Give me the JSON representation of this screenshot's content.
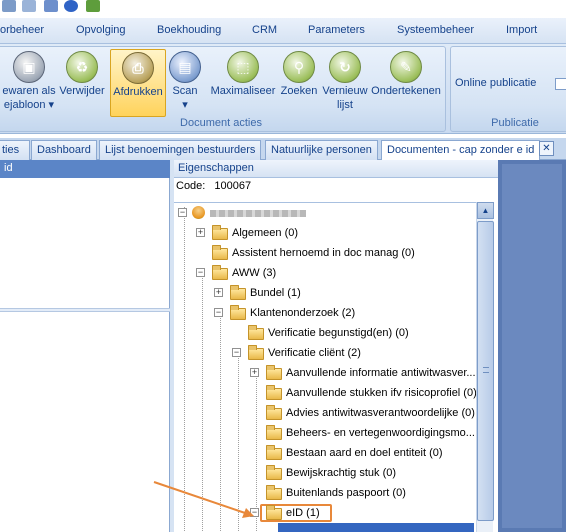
{
  "menu": {
    "tabs": [
      "orbeheer",
      "Opvolging",
      "Boekhouding",
      "CRM",
      "Parameters",
      "Systeembeheer",
      "Import"
    ]
  },
  "ribbon": {
    "buttons": [
      {
        "label": "ewaren als",
        "label2": "ejabloon ▾",
        "icon": "save-template-icon"
      },
      {
        "label": "Verwijder",
        "label2": "",
        "icon": "delete-icon"
      },
      {
        "label": "Afdrukken",
        "label2": "",
        "icon": "print-icon"
      },
      {
        "label": "Scan",
        "label2": "▾",
        "icon": "scan-icon"
      },
      {
        "label": "Maximaliseer",
        "label2": "",
        "icon": "maximize-icon"
      },
      {
        "label": "Zoeken",
        "label2": "",
        "icon": "search-icon"
      },
      {
        "label": "Vernieuw",
        "label2": "lijst",
        "icon": "refresh-icon"
      },
      {
        "label": "Ondertekenen",
        "label2": "",
        "icon": "sign-icon"
      }
    ],
    "group_label": "Document acties",
    "publicatie": {
      "online_label": "Online publicatie",
      "group_label": "Publicatie"
    }
  },
  "doc_tabs": [
    {
      "label": "ties"
    },
    {
      "label": "Dashboard"
    },
    {
      "label": "Lijst benoemingen bestuurders"
    },
    {
      "label": "Natuurlijke personen"
    },
    {
      "label": "Documenten - cap zonder e id"
    }
  ],
  "left_panel": {
    "header": "id"
  },
  "properties": {
    "header": "Eigenschappen",
    "code_label": "Code:",
    "code_value": "100067"
  },
  "tree": [
    {
      "label": "Algemeen (0)",
      "level": 1
    },
    {
      "label": "Assistent hernoemd in doc manag (0)",
      "level": 1
    },
    {
      "label": "AWW (3)",
      "level": 1
    },
    {
      "label": "Bundel (1)",
      "level": 2
    },
    {
      "label": "Klantenonderzoek (2)",
      "level": 2
    },
    {
      "label": "Verificatie begunstigd(en) (0)",
      "level": 3
    },
    {
      "label": "Verificatie cliënt (2)",
      "level": 3
    },
    {
      "label": "Aanvullende informatie antiwitwasver...",
      "level": 4
    },
    {
      "label": "Aanvullende stukken ifv risicoprofiel (0)",
      "level": 4
    },
    {
      "label": "Advies antiwitwasverantwoordelijke (0)",
      "level": 4
    },
    {
      "label": "Beheers- en vertegenwoordigingsmo...",
      "level": 4
    },
    {
      "label": "Bestaan aard en doel entiteit (0)",
      "level": 4
    },
    {
      "label": "Bewijskrachtig stuk (0)",
      "level": 4
    },
    {
      "label": "Buitenlands paspoort (0)",
      "level": 4
    },
    {
      "label": "eID (1)",
      "level": 4
    }
  ],
  "colors": {
    "accent": "#ffd35c",
    "selection": "#3466c0",
    "arrow": "#e8883a"
  }
}
